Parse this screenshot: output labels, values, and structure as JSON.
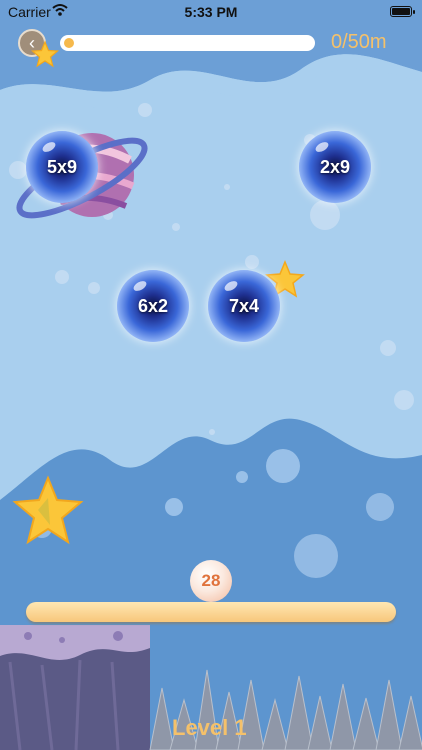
{
  "status_bar": {
    "carrier": "Carrier",
    "time": "5:33 PM"
  },
  "hud": {
    "distance": "0/50m",
    "progress": 0.0
  },
  "bubbles": [
    {
      "label": "5x9"
    },
    {
      "label": "2x9"
    },
    {
      "label": "6x2"
    },
    {
      "label": "7x4"
    }
  ],
  "ball": {
    "value": "28"
  },
  "footer": {
    "level": "Level 1"
  },
  "colors": {
    "sky": "#a9cfee",
    "hill": "#5d95cf",
    "accent": "#f5c16a",
    "ball_text": "#e0733d"
  },
  "icons": [
    "back-arrow-icon",
    "star-icon",
    "planet-icon",
    "wifi-icon",
    "battery-icon"
  ]
}
